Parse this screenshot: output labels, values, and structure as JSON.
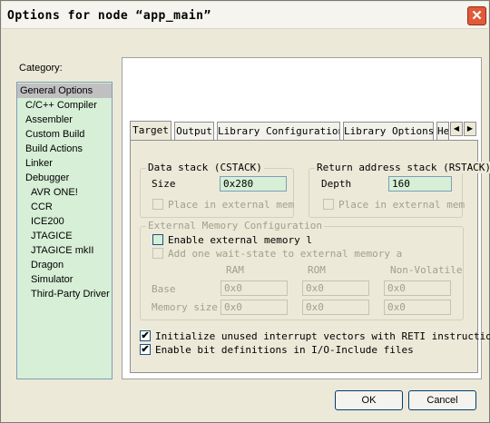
{
  "window": {
    "title": "Options for node “app_main”"
  },
  "category": {
    "label": "Category:",
    "items": [
      "General Options",
      "C/C++ Compiler",
      "Assembler",
      "Custom Build",
      "Build Actions",
      "Linker",
      "Debugger",
      "AVR ONE!",
      "CCR",
      "ICE200",
      "JTAGICE",
      "JTAGICE mkII",
      "Dragon",
      "Simulator",
      "Third-Party Driver"
    ],
    "selected": "General Options"
  },
  "tabs": [
    "Target",
    "Output",
    "Library Configuration",
    "Library Options",
    "He"
  ],
  "active_tab": "Target",
  "data_stack": {
    "legend": "Data stack (CSTACK)",
    "size_label": "Size",
    "size_value": "0x280",
    "ext_mem_label": "Place in external mem",
    "ext_mem_checked": false
  },
  "return_stack": {
    "legend": "Return address stack (RSTACK)",
    "depth_label": "Depth",
    "depth_value": "160",
    "ext_mem_label": "Place in external mem",
    "ext_mem_checked": false
  },
  "ext_memory": {
    "legend": "External Memory Configuration",
    "enable_label": "Enable external memory l",
    "enable_checked": false,
    "wait_state_label": "Add one wait-state to external memory a",
    "wait_state_checked": false,
    "col_ram": "RAM",
    "col_rom": "ROM",
    "col_nv": "Non-Volatile",
    "base_label": "Base",
    "memsize_label": "Memory size",
    "base_ram": "0x0",
    "base_rom": "0x0",
    "base_nv": "0x0",
    "size_ram": "0x0",
    "size_rom": "0x0",
    "size_nv": "0x0"
  },
  "init_vectors": {
    "label": "Initialize unused interrupt vectors with RETI instruction",
    "checked": true
  },
  "bit_defs": {
    "label": "Enable bit definitions in I/O-Include files",
    "checked": true
  },
  "buttons": {
    "ok": "OK",
    "cancel": "Cancel"
  },
  "icons": {
    "close": "close-icon",
    "tab_left": "arrow-left-icon",
    "tab_right": "arrow-right-icon",
    "check": "✔"
  }
}
